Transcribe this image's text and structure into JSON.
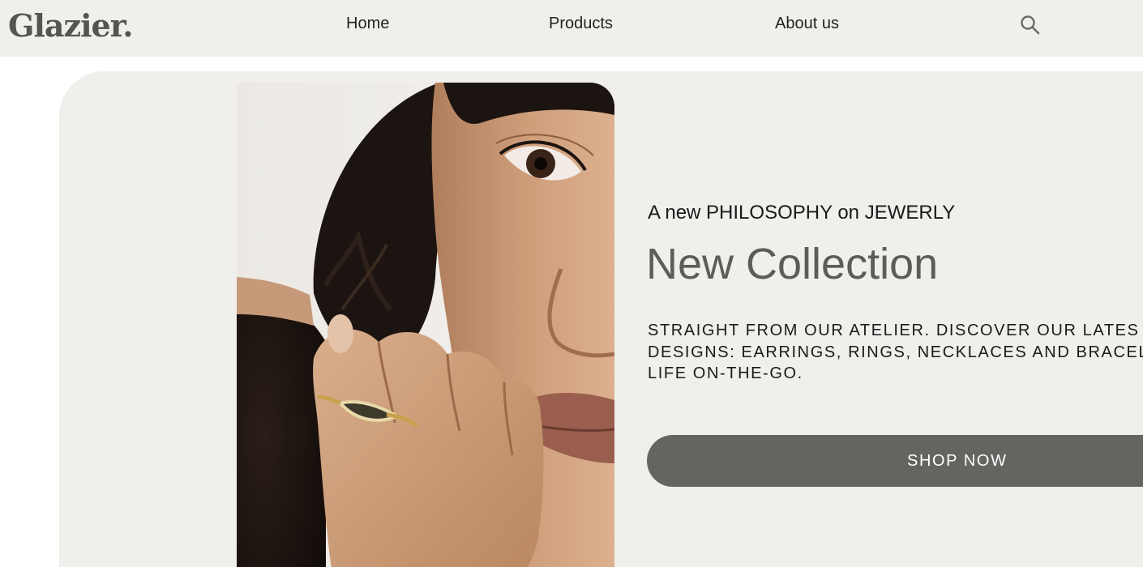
{
  "header": {
    "logo": "Glazier.",
    "nav": {
      "home": "Home",
      "products": "Products",
      "about": "About us"
    },
    "search_icon": "search-icon"
  },
  "hero": {
    "image": "portrait-woman-with-ring",
    "tagline": "A new PHILOSOPHY on JEWERLY",
    "title": "New Collection",
    "description": [
      "STRAIGHT FROM OUR ATELIER. DISCOVER OUR LATES",
      "DESIGNS: EARRINGS, RINGS, NECKLACES AND BRACEL",
      "LIFE ON-THE-GO."
    ],
    "cta": "SHOP NOW"
  },
  "colors": {
    "background": "#f0efec",
    "accent": "#656461",
    "title": "#5d5c59"
  }
}
